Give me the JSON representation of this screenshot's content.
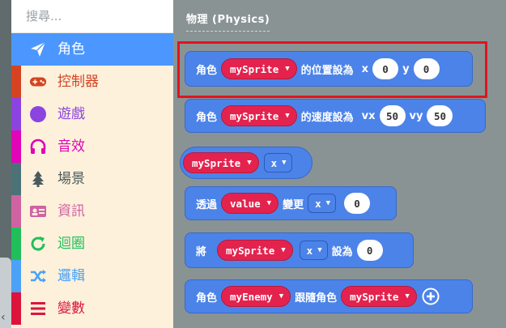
{
  "search": {
    "placeholder": "搜尋..."
  },
  "categories": [
    {
      "label": "角色",
      "icon": "paper-plane-icon",
      "color": "#4c97ff",
      "selected": true
    },
    {
      "label": "控制器",
      "icon": "gamepad-icon",
      "color": "#d54322"
    },
    {
      "label": "遊戲",
      "icon": "circle-icon",
      "color": "#8b44e0"
    },
    {
      "label": "音效",
      "icon": "headphones-icon",
      "color": "#e005b6"
    },
    {
      "label": "場景",
      "icon": "tree-icon",
      "color": "#4b7277"
    },
    {
      "label": "資訊",
      "icon": "id-card-icon",
      "color": "#cf63a1"
    },
    {
      "label": "迴圈",
      "icon": "refresh-icon",
      "color": "#20bf5a"
    },
    {
      "label": "邏輯",
      "icon": "shuffle-icon",
      "color": "#4ba2f7"
    },
    {
      "label": "變數",
      "icon": "list-icon",
      "color": "#dc143c"
    }
  ],
  "workspace": {
    "section_title": "物理 (Physics)",
    "blocks": {
      "set_position": {
        "sprite": "角色",
        "var": "mySprite",
        "text": "的位置設為",
        "x_label": "x",
        "x": "0",
        "y_label": "y",
        "y": "0"
      },
      "set_velocity": {
        "sprite": "角色",
        "var": "mySprite",
        "text": "的速度設為",
        "vx_label": "vx",
        "vx": "50",
        "vy_label": "vy",
        "vy": "50"
      },
      "prop_reporter": {
        "var": "mySprite",
        "prop": "x"
      },
      "change_by": {
        "text": "透過",
        "var": "value",
        "change": "變更",
        "prop": "x",
        "value": "0"
      },
      "set_prop": {
        "text": "將",
        "var": "mySprite",
        "prop": "x",
        "set": "設為",
        "value": "0"
      },
      "follow": {
        "sprite": "角色",
        "var": "myEnemy",
        "text": "跟隨角色",
        "target": "mySprite"
      }
    }
  },
  "colors": {
    "workspace_bg": "#8a9394",
    "sprite_block": "#4c83e9",
    "variable_pill": "#e3234e",
    "highlight": "#e0141e"
  }
}
